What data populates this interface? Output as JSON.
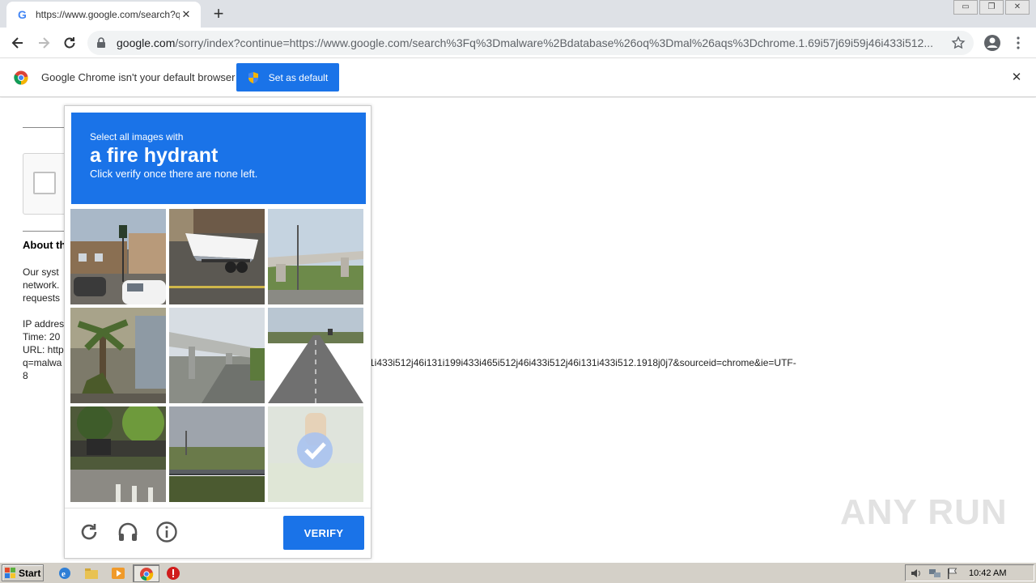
{
  "browser": {
    "tab_title": "https://www.google.com/search?q=",
    "url_host": "google.com",
    "url_rest": "/sorry/index?continue=https://www.google.com/search%3Fq%3Dmalware%2Bdatabase%26oq%3Dmal%26aqs%3Dchrome.1.69i57j69i59j46i433i512...",
    "window_controls": [
      "▭",
      "❐",
      "✕"
    ]
  },
  "infobar": {
    "message": "Google Chrome isn't your default browser",
    "button_label": "Set as default"
  },
  "page": {
    "about_heading": "About th",
    "paragraph_lines": [
      "Our syst",
      "network.",
      "requests"
    ],
    "ip_line": "IP addres",
    "time_line": "Time: 20",
    "url_line": "URL: http",
    "q_line_start": "q=malwa",
    "q_line_end": "1i433i512j46i131i199i433i465i512j46i433i512j46i131i433i512.1918j0j7&sourceid=chrome&ie=UTF-",
    "last_line": "8"
  },
  "challenge": {
    "line1": "Select all images with",
    "line2": "a fire hydrant",
    "line3": "Click verify once there are none left.",
    "verify_label": "VERIFY",
    "tiles": [
      {
        "name": "street-intersection",
        "selected": false
      },
      {
        "name": "boat-trailer",
        "selected": false
      },
      {
        "name": "overpass",
        "selected": false
      },
      {
        "name": "palm-trees",
        "selected": false
      },
      {
        "name": "bridge-road",
        "selected": false
      },
      {
        "name": "highway",
        "selected": false
      },
      {
        "name": "trees-park",
        "selected": false
      },
      {
        "name": "field-fence",
        "selected": false
      },
      {
        "name": "fire-hydrant",
        "selected": true
      }
    ],
    "colors": {
      "accent": "#1a73e8"
    }
  },
  "watermark": "ANY RUN",
  "taskbar": {
    "start_label": "Start",
    "clock": "10:42 AM"
  }
}
